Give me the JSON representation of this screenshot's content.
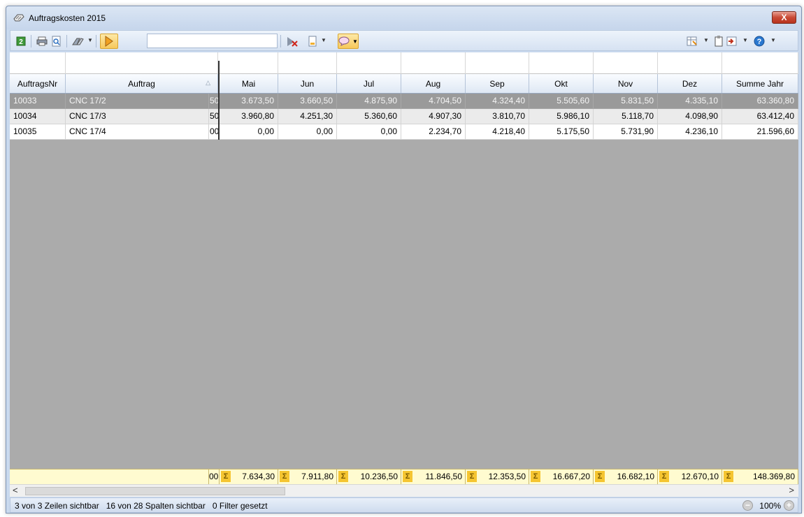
{
  "window": {
    "title": "Auftragskosten 2015",
    "close_label": "X"
  },
  "toolbar": {
    "search_value": "",
    "icons": [
      "refresh-icon",
      "print-icon",
      "print-preview-icon",
      "tools-icon",
      "filter-icon",
      "clear-filter-icon",
      "export-icon",
      "comment-icon",
      "column-chooser-icon",
      "clipboard-icon",
      "layout-icon",
      "help-icon"
    ]
  },
  "grid": {
    "columns": [
      {
        "key": "nr",
        "label": "AuftragsNr"
      },
      {
        "key": "auftrag",
        "label": "Auftrag"
      },
      {
        "key": "mai",
        "label": "Mai"
      },
      {
        "key": "jun",
        "label": "Jun"
      },
      {
        "key": "jul",
        "label": "Jul"
      },
      {
        "key": "aug",
        "label": "Aug"
      },
      {
        "key": "sep",
        "label": "Sep"
      },
      {
        "key": "okt",
        "label": "Okt"
      },
      {
        "key": "nov",
        "label": "Nov"
      },
      {
        "key": "dez",
        "label": "Dez"
      },
      {
        "key": "summe",
        "label": "Summe Jahr"
      }
    ],
    "rows": [
      {
        "nr": "10033",
        "auftrag": "CNC 17/2",
        "clip": "50",
        "mai": "3.673,50",
        "jun": "3.660,50",
        "jul": "4.875,90",
        "aug": "4.704,50",
        "sep": "4.324,40",
        "okt": "5.505,60",
        "nov": "5.831,50",
        "dez": "4.335,10",
        "summe": "63.360,80"
      },
      {
        "nr": "10034",
        "auftrag": "CNC 17/3",
        "clip": "50",
        "mai": "3.960,80",
        "jun": "4.251,30",
        "jul": "5.360,60",
        "aug": "4.907,30",
        "sep": "3.810,70",
        "okt": "5.986,10",
        "nov": "5.118,70",
        "dez": "4.098,90",
        "summe": "63.412,40"
      },
      {
        "nr": "10035",
        "auftrag": "CNC 17/4",
        "clip": "00",
        "mai": "0,00",
        "jun": "0,00",
        "jul": "0,00",
        "aug": "2.234,70",
        "sep": "4.218,40",
        "okt": "5.175,50",
        "nov": "5.731,90",
        "dez": "4.236,10",
        "summe": "21.596,60"
      }
    ],
    "sums": {
      "clip": "00",
      "sigma": "Σ",
      "mai": "7.634,30",
      "jun": "7.911,80",
      "jul": "10.236,50",
      "aug": "11.846,50",
      "sep": "12.353,50",
      "okt": "16.667,20",
      "nov": "16.682,10",
      "dez": "12.670,10",
      "summe": "148.369,80"
    }
  },
  "scrollbar": {
    "left_arrow": "<",
    "right_arrow": ">"
  },
  "status": {
    "rows_visible": "3 von 3 Zeilen sichtbar",
    "cols_visible": "16 von 28 Spalten sichtbar",
    "filters": "0 Filter gesetzt",
    "zoom": "100%"
  }
}
